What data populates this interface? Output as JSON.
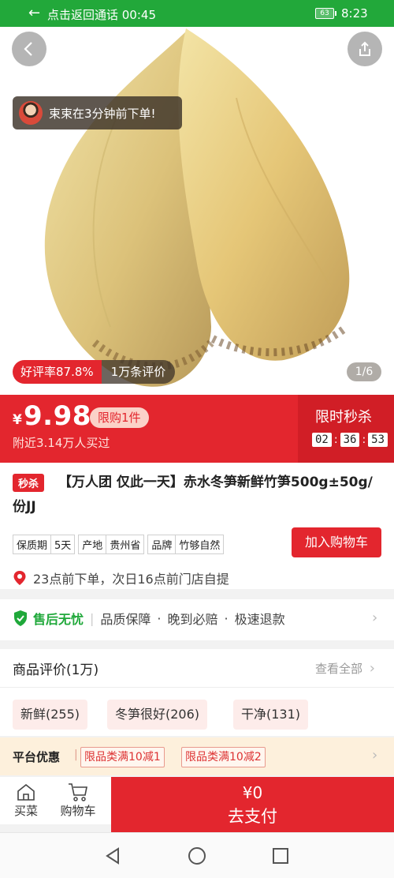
{
  "status_bar": {
    "call_text": "点击返回通话 00:45",
    "battery": "63",
    "time": "8:23"
  },
  "hero": {
    "toast_text": "束束在3分钟前下单!",
    "rating": "好评率87.8%",
    "review_count": "1万条评价",
    "pager": "1/6"
  },
  "price": {
    "currency": "¥",
    "value": "9.98",
    "limit": "限购1件",
    "sold": "附近3.14万人买过",
    "flash_title": "限时秒杀",
    "countdown": [
      "02",
      "36",
      "53"
    ]
  },
  "product": {
    "tag": "秒杀",
    "title": "【万人团 仅此一天】赤水冬笋新鲜竹笋500g±50g/份JJ",
    "specs": [
      {
        "key": "保质期",
        "value": "5天"
      },
      {
        "key": "产地",
        "value": "贵州省"
      },
      {
        "key": "品牌",
        "value": "竹够自然"
      }
    ],
    "add_cart": "加入购物车",
    "pickup": "23点前下单，次日16点前门店自提"
  },
  "after_sale": {
    "title": "售后无忧",
    "items": [
      "品质保障",
      "·",
      "晚到必赔",
      "·",
      "极速退款"
    ]
  },
  "reviews": {
    "title": "商品评价(1万)",
    "view_all": "查看全部",
    "tags": [
      "新鲜(255)",
      "冬笋很好(206)",
      "干净(131)"
    ]
  },
  "offers": {
    "title": "平台优惠",
    "coupons": [
      "限品类满10减1",
      "限品类满10减2"
    ]
  },
  "bottom": {
    "home": "买菜",
    "cart": "购物车",
    "pay_amount": "¥0",
    "pay_label": "去支付"
  },
  "colors": {
    "brand_red": "#e3262e",
    "brand_green": "#22a83a"
  }
}
